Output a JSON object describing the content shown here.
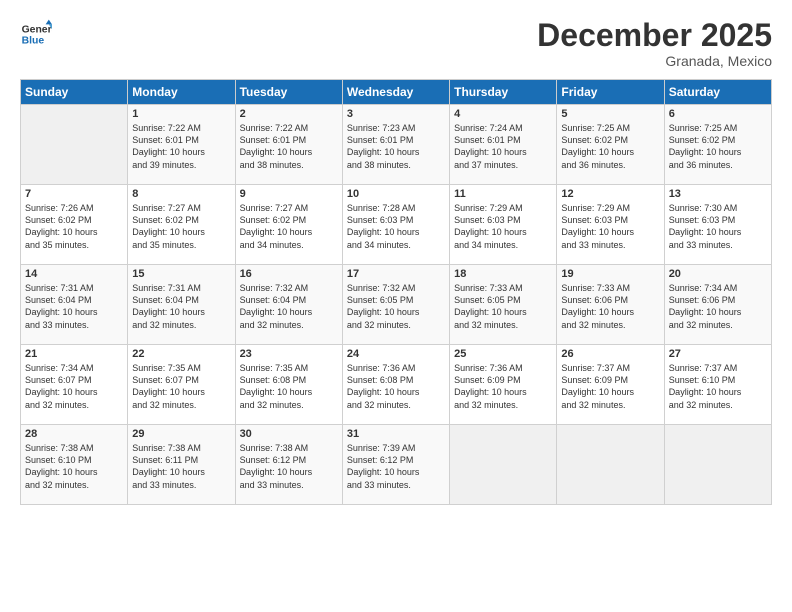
{
  "logo": {
    "line1": "General",
    "line2": "Blue"
  },
  "title": "December 2025",
  "location": "Granada, Mexico",
  "days_header": [
    "Sunday",
    "Monday",
    "Tuesday",
    "Wednesday",
    "Thursday",
    "Friday",
    "Saturday"
  ],
  "weeks": [
    [
      {
        "day": "",
        "content": ""
      },
      {
        "day": "1",
        "content": "Sunrise: 7:22 AM\nSunset: 6:01 PM\nDaylight: 10 hours\nand 39 minutes."
      },
      {
        "day": "2",
        "content": "Sunrise: 7:22 AM\nSunset: 6:01 PM\nDaylight: 10 hours\nand 38 minutes."
      },
      {
        "day": "3",
        "content": "Sunrise: 7:23 AM\nSunset: 6:01 PM\nDaylight: 10 hours\nand 38 minutes."
      },
      {
        "day": "4",
        "content": "Sunrise: 7:24 AM\nSunset: 6:01 PM\nDaylight: 10 hours\nand 37 minutes."
      },
      {
        "day": "5",
        "content": "Sunrise: 7:25 AM\nSunset: 6:02 PM\nDaylight: 10 hours\nand 36 minutes."
      },
      {
        "day": "6",
        "content": "Sunrise: 7:25 AM\nSunset: 6:02 PM\nDaylight: 10 hours\nand 36 minutes."
      }
    ],
    [
      {
        "day": "7",
        "content": "Sunrise: 7:26 AM\nSunset: 6:02 PM\nDaylight: 10 hours\nand 35 minutes."
      },
      {
        "day": "8",
        "content": "Sunrise: 7:27 AM\nSunset: 6:02 PM\nDaylight: 10 hours\nand 35 minutes."
      },
      {
        "day": "9",
        "content": "Sunrise: 7:27 AM\nSunset: 6:02 PM\nDaylight: 10 hours\nand 34 minutes."
      },
      {
        "day": "10",
        "content": "Sunrise: 7:28 AM\nSunset: 6:03 PM\nDaylight: 10 hours\nand 34 minutes."
      },
      {
        "day": "11",
        "content": "Sunrise: 7:29 AM\nSunset: 6:03 PM\nDaylight: 10 hours\nand 34 minutes."
      },
      {
        "day": "12",
        "content": "Sunrise: 7:29 AM\nSunset: 6:03 PM\nDaylight: 10 hours\nand 33 minutes."
      },
      {
        "day": "13",
        "content": "Sunrise: 7:30 AM\nSunset: 6:03 PM\nDaylight: 10 hours\nand 33 minutes."
      }
    ],
    [
      {
        "day": "14",
        "content": "Sunrise: 7:31 AM\nSunset: 6:04 PM\nDaylight: 10 hours\nand 33 minutes."
      },
      {
        "day": "15",
        "content": "Sunrise: 7:31 AM\nSunset: 6:04 PM\nDaylight: 10 hours\nand 32 minutes."
      },
      {
        "day": "16",
        "content": "Sunrise: 7:32 AM\nSunset: 6:04 PM\nDaylight: 10 hours\nand 32 minutes."
      },
      {
        "day": "17",
        "content": "Sunrise: 7:32 AM\nSunset: 6:05 PM\nDaylight: 10 hours\nand 32 minutes."
      },
      {
        "day": "18",
        "content": "Sunrise: 7:33 AM\nSunset: 6:05 PM\nDaylight: 10 hours\nand 32 minutes."
      },
      {
        "day": "19",
        "content": "Sunrise: 7:33 AM\nSunset: 6:06 PM\nDaylight: 10 hours\nand 32 minutes."
      },
      {
        "day": "20",
        "content": "Sunrise: 7:34 AM\nSunset: 6:06 PM\nDaylight: 10 hours\nand 32 minutes."
      }
    ],
    [
      {
        "day": "21",
        "content": "Sunrise: 7:34 AM\nSunset: 6:07 PM\nDaylight: 10 hours\nand 32 minutes."
      },
      {
        "day": "22",
        "content": "Sunrise: 7:35 AM\nSunset: 6:07 PM\nDaylight: 10 hours\nand 32 minutes."
      },
      {
        "day": "23",
        "content": "Sunrise: 7:35 AM\nSunset: 6:08 PM\nDaylight: 10 hours\nand 32 minutes."
      },
      {
        "day": "24",
        "content": "Sunrise: 7:36 AM\nSunset: 6:08 PM\nDaylight: 10 hours\nand 32 minutes."
      },
      {
        "day": "25",
        "content": "Sunrise: 7:36 AM\nSunset: 6:09 PM\nDaylight: 10 hours\nand 32 minutes."
      },
      {
        "day": "26",
        "content": "Sunrise: 7:37 AM\nSunset: 6:09 PM\nDaylight: 10 hours\nand 32 minutes."
      },
      {
        "day": "27",
        "content": "Sunrise: 7:37 AM\nSunset: 6:10 PM\nDaylight: 10 hours\nand 32 minutes."
      }
    ],
    [
      {
        "day": "28",
        "content": "Sunrise: 7:38 AM\nSunset: 6:10 PM\nDaylight: 10 hours\nand 32 minutes."
      },
      {
        "day": "29",
        "content": "Sunrise: 7:38 AM\nSunset: 6:11 PM\nDaylight: 10 hours\nand 33 minutes."
      },
      {
        "day": "30",
        "content": "Sunrise: 7:38 AM\nSunset: 6:12 PM\nDaylight: 10 hours\nand 33 minutes."
      },
      {
        "day": "31",
        "content": "Sunrise: 7:39 AM\nSunset: 6:12 PM\nDaylight: 10 hours\nand 33 minutes."
      },
      {
        "day": "",
        "content": ""
      },
      {
        "day": "",
        "content": ""
      },
      {
        "day": "",
        "content": ""
      }
    ]
  ],
  "accent_color": "#1a6eb5"
}
